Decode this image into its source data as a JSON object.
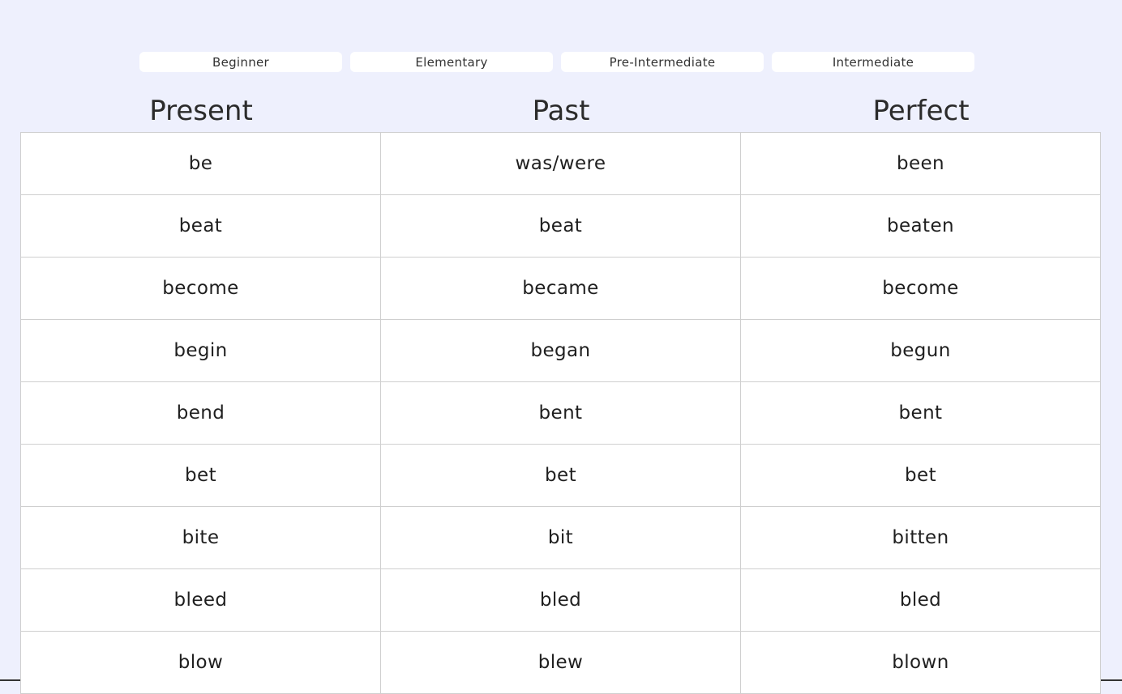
{
  "levels": [
    {
      "label": "Beginner"
    },
    {
      "label": "Elementary"
    },
    {
      "label": "Pre-Intermediate"
    },
    {
      "label": "Intermediate"
    }
  ],
  "columns": [
    "Present",
    "Past",
    "Perfect"
  ],
  "rows": [
    [
      "be",
      "was/were",
      "been"
    ],
    [
      "beat",
      "beat",
      "beaten"
    ],
    [
      "become",
      "became",
      "become"
    ],
    [
      "begin",
      "began",
      "begun"
    ],
    [
      "bend",
      "bent",
      "bent"
    ],
    [
      "bet",
      "bet",
      "bet"
    ],
    [
      "bite",
      "bit",
      "bitten"
    ],
    [
      "bleed",
      "bled",
      "bled"
    ],
    [
      "blow",
      "blew",
      "blown"
    ]
  ]
}
